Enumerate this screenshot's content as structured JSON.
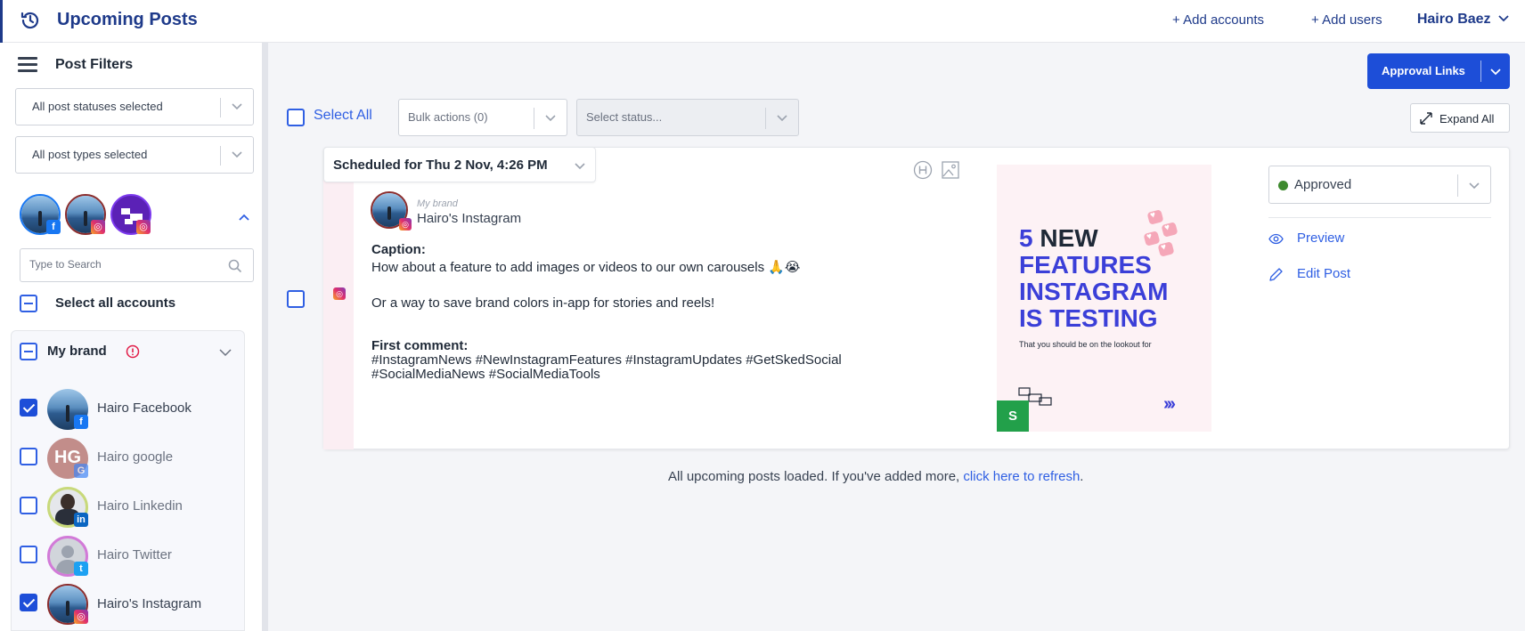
{
  "header": {
    "title": "Upcoming Posts",
    "add_accounts": "+  Add accounts",
    "add_users": "+  Add users",
    "user_name": "Hairo Baez"
  },
  "sidebar": {
    "title": "Post Filters",
    "status_filter": "All post statuses selected",
    "type_filter": "All post types selected",
    "search_placeholder": "Type to Search",
    "select_all_accounts": "Select all accounts",
    "group": {
      "name": "My brand",
      "accounts": [
        {
          "name": "Hairo Facebook",
          "network": "facebook",
          "checked": true
        },
        {
          "name": "Hairo google",
          "network": "google",
          "checked": false,
          "initials": "HG"
        },
        {
          "name": "Hairo Linkedin",
          "network": "linkedin",
          "checked": false
        },
        {
          "name": "Hairo Twitter",
          "network": "twitter",
          "checked": false
        },
        {
          "name": "Hairo's Instagram",
          "network": "instagram",
          "checked": true
        }
      ]
    }
  },
  "toolbar": {
    "approval_links": "Approval Links",
    "select_all": "Select All",
    "bulk_actions": "Bulk actions (0)",
    "status_placeholder": "Select status...",
    "expand_all": "Expand All"
  },
  "post": {
    "scheduled": "Scheduled for Thu 2 Nov, 4:26 PM",
    "brand": "My brand",
    "account": "Hairo's Instagram",
    "caption_label": "Caption:",
    "caption_line1": "How about a feature to add images or videos to our own carousels 🙏😭",
    "caption_line2": "Or a way to save brand colors in-app for stories and reels!",
    "first_comment_label": "First comment:",
    "first_comment_line1": "#InstagramNews #NewInstagramFeatures #InstagramUpdates #GetSkedSocial",
    "first_comment_line2": "#SocialMediaNews #SocialMediaTools",
    "image": {
      "number": "5",
      "word_new": "NEW",
      "line2": "FEATURES",
      "line3": "INSTAGRAM",
      "line4": "IS TESTING",
      "sub": "That you should be on the lookout for",
      "arrows": "›››",
      "badge": "S"
    },
    "status": "Approved",
    "status_color": "#3e8a2e",
    "preview": "Preview",
    "edit": "Edit Post"
  },
  "footer": {
    "message": "All upcoming posts loaded. If you've added more, ",
    "refresh_link": "click here to refresh",
    "end": "."
  },
  "colors": {
    "brand_navy": "#1e3a8a",
    "accent_blue": "#1d4ed8",
    "link_blue": "#2f5fe3"
  }
}
